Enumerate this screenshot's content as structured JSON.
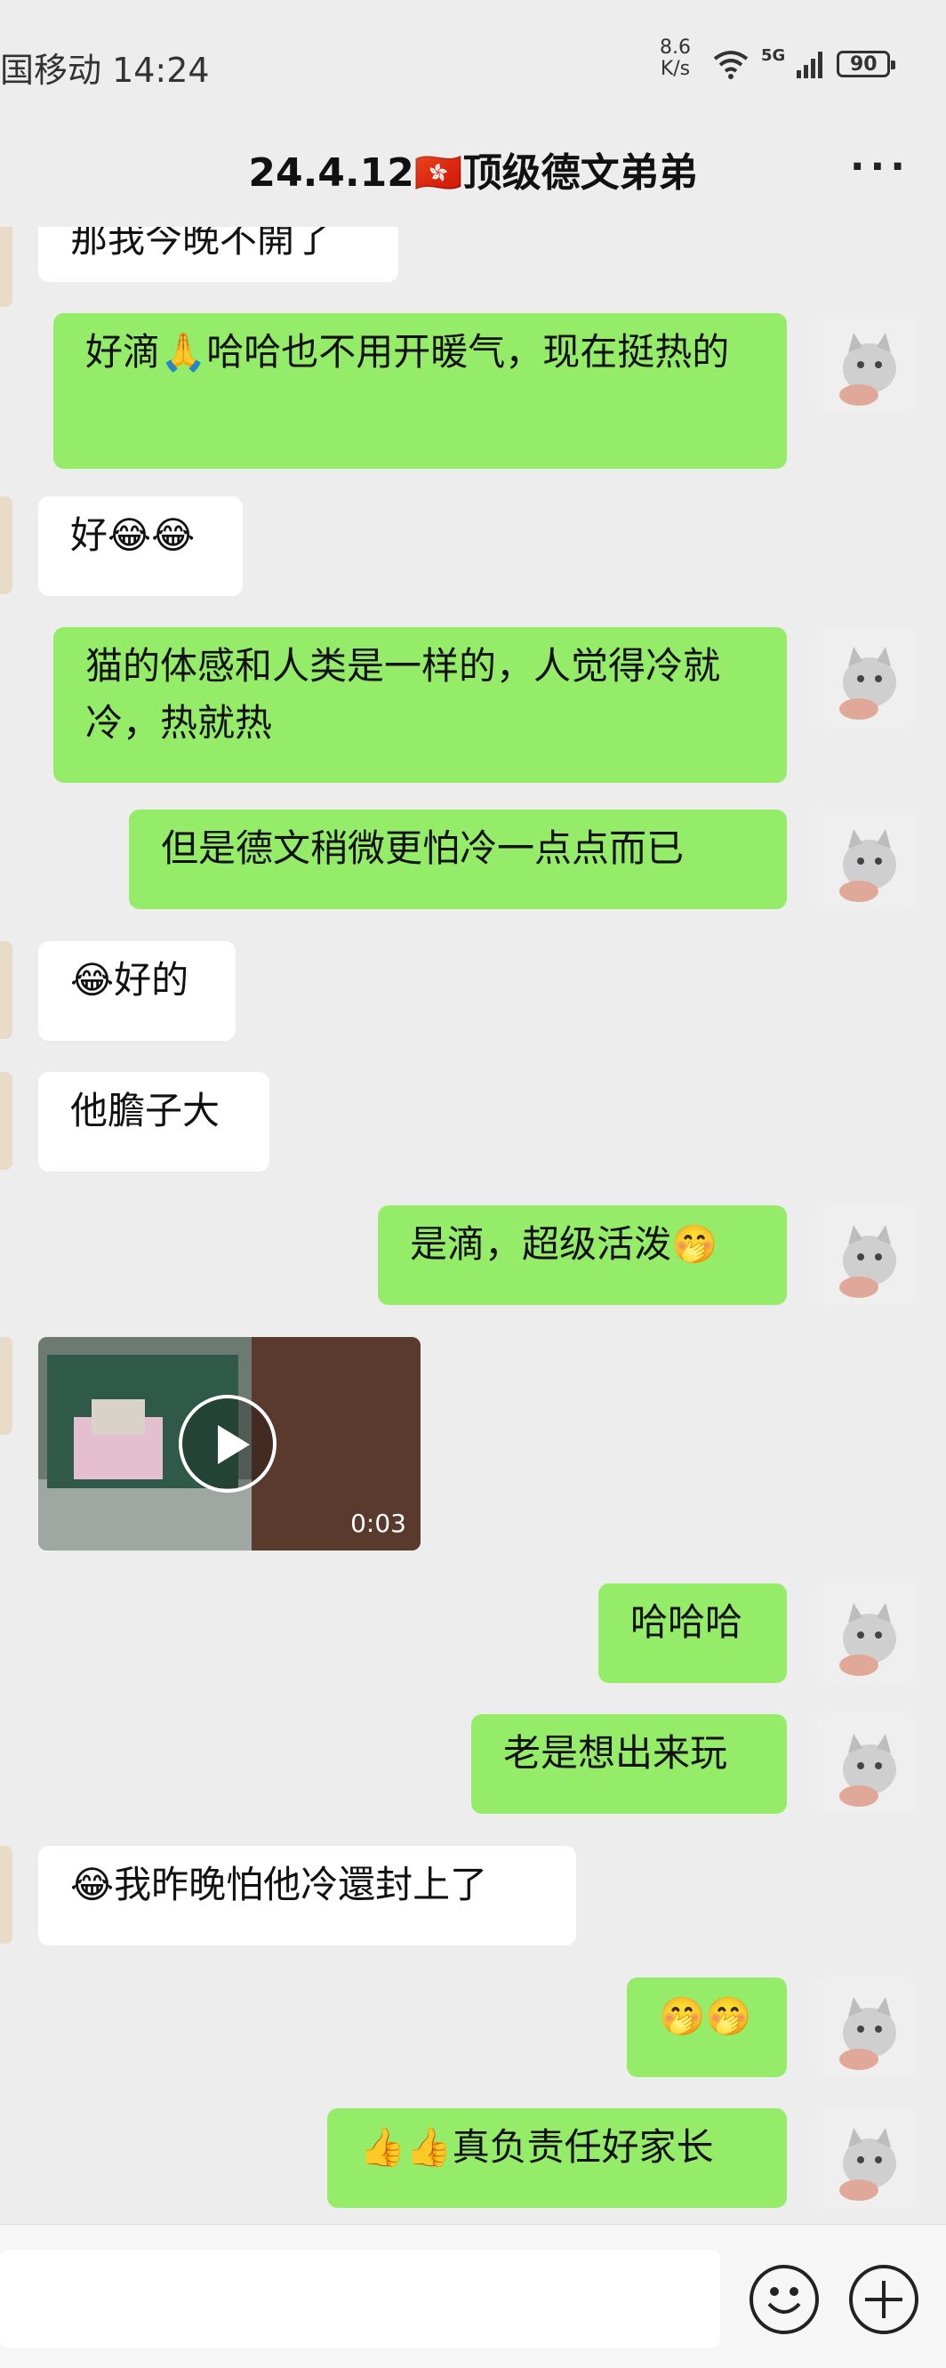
{
  "status_bar": {
    "carrier_time": "国移动 14:24",
    "speed_value": "8.6",
    "speed_unit": "K/s",
    "network": "5G",
    "battery": "90"
  },
  "header": {
    "title": "24.4.12🇭🇰顶级德文弟弟",
    "more": "···"
  },
  "messages": [
    {
      "side": "other",
      "text": "那我今晚不開了"
    },
    {
      "side": "me",
      "text": "好滴🙏哈哈也不用开暖气，现在挺热的"
    },
    {
      "side": "other",
      "text": "好😂😂"
    },
    {
      "side": "me",
      "text": "猫的体感和人类是一样的，人觉得冷就冷，热就热"
    },
    {
      "side": "me",
      "text": "但是德文稍微更怕冷一点点而已"
    },
    {
      "side": "other",
      "text": "😂好的"
    },
    {
      "side": "other",
      "text": "他膽子大"
    },
    {
      "side": "me",
      "text": "是滴，超级活泼🤭"
    },
    {
      "side": "other",
      "type": "video",
      "duration": "0:03"
    },
    {
      "side": "me",
      "text": "哈哈哈"
    },
    {
      "side": "me",
      "text": "老是想出来玩"
    },
    {
      "side": "other",
      "text": "😂我昨晚怕他冷還封上了"
    },
    {
      "side": "me",
      "text": "🤭🤭"
    },
    {
      "side": "me",
      "text": "👍👍真负责任好家长"
    }
  ]
}
